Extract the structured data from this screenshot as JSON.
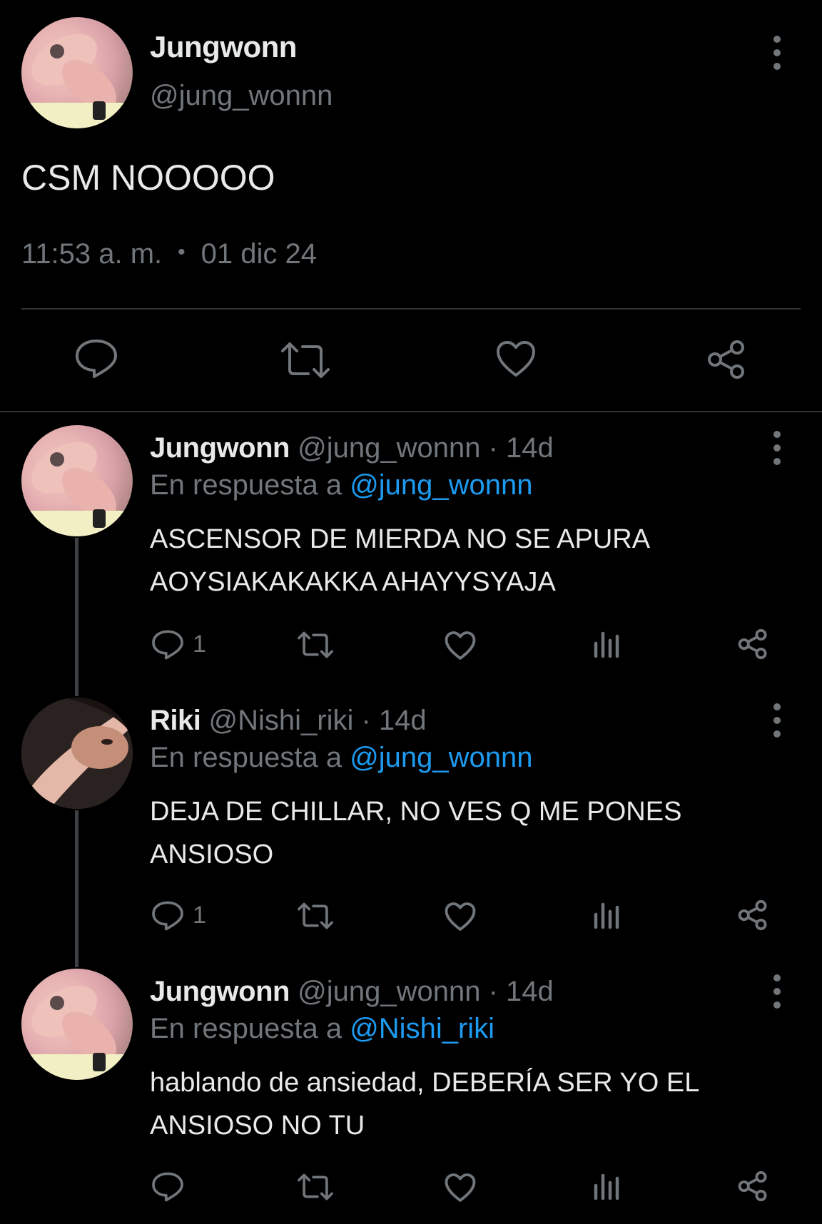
{
  "main_tweet": {
    "author_name": "Jungwonn",
    "author_handle": "@jung_wonnn",
    "text": "CSM NOOOOO",
    "time": "11:53 a. m.",
    "separator": "•",
    "date": "01 dic 24",
    "actions": [
      "reply-icon",
      "retweet-icon",
      "like-icon",
      "share-icon"
    ]
  },
  "replies": [
    {
      "author_name": "Jungwonn",
      "author_handle": "@jung_wonnn",
      "age": "· 14d",
      "reply_prefix": "En respuesta a",
      "reply_to": "@jung_wonnn",
      "text": "ASCENSOR DE MIERDA NO SE APURA AOYSIAKAKAKKA AHAYYSYAJA",
      "reply_count": "1"
    },
    {
      "author_name": "Riki",
      "author_handle": "@Nishi_riki",
      "age": "· 14d",
      "reply_prefix": "En respuesta a",
      "reply_to": "@jung_wonnn",
      "text": "DEJA DE CHILLAR, NO VES Q ME PONES ANSIOSO",
      "reply_count": "1"
    },
    {
      "author_name": "Jungwonn",
      "author_handle": "@jung_wonnn",
      "age": "· 14d",
      "reply_prefix": "En respuesta a",
      "reply_to": "@Nishi_riki",
      "text": "hablando de ansiedad, DEBERÍA SER YO EL ANSIOSO NO TU",
      "reply_count": ""
    }
  ],
  "colors": {
    "background": "#000000",
    "text_primary": "#e7e9ea",
    "text_secondary": "#71767b",
    "link": "#1d9bf0",
    "divider": "#2f3336"
  }
}
